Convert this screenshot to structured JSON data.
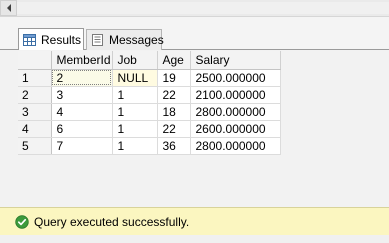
{
  "tabs": {
    "results_label": "Results",
    "messages_label": "Messages"
  },
  "grid": {
    "columns": [
      "MemberId",
      "Job",
      "Age",
      "Salary"
    ],
    "rows": [
      {
        "num": "1",
        "cells": [
          "2",
          "NULL",
          "19",
          "2500.000000"
        ]
      },
      {
        "num": "2",
        "cells": [
          "3",
          "1",
          "22",
          "2100.000000"
        ]
      },
      {
        "num": "3",
        "cells": [
          "4",
          "1",
          "18",
          "2800.000000"
        ]
      },
      {
        "num": "4",
        "cells": [
          "6",
          "1",
          "22",
          "2600.000000"
        ]
      },
      {
        "num": "5",
        "cells": [
          "7",
          "1",
          "36",
          "2800.000000"
        ]
      }
    ]
  },
  "status": {
    "text": "Query executed successfully.",
    "icon": "check-circle-icon",
    "background": "#fbf6c0",
    "icon_color": "#3c9a3c"
  },
  "icons": {
    "results_tab": "grid-icon",
    "messages_tab": "messages-icon",
    "scroll_left": "arrow-left-icon"
  }
}
